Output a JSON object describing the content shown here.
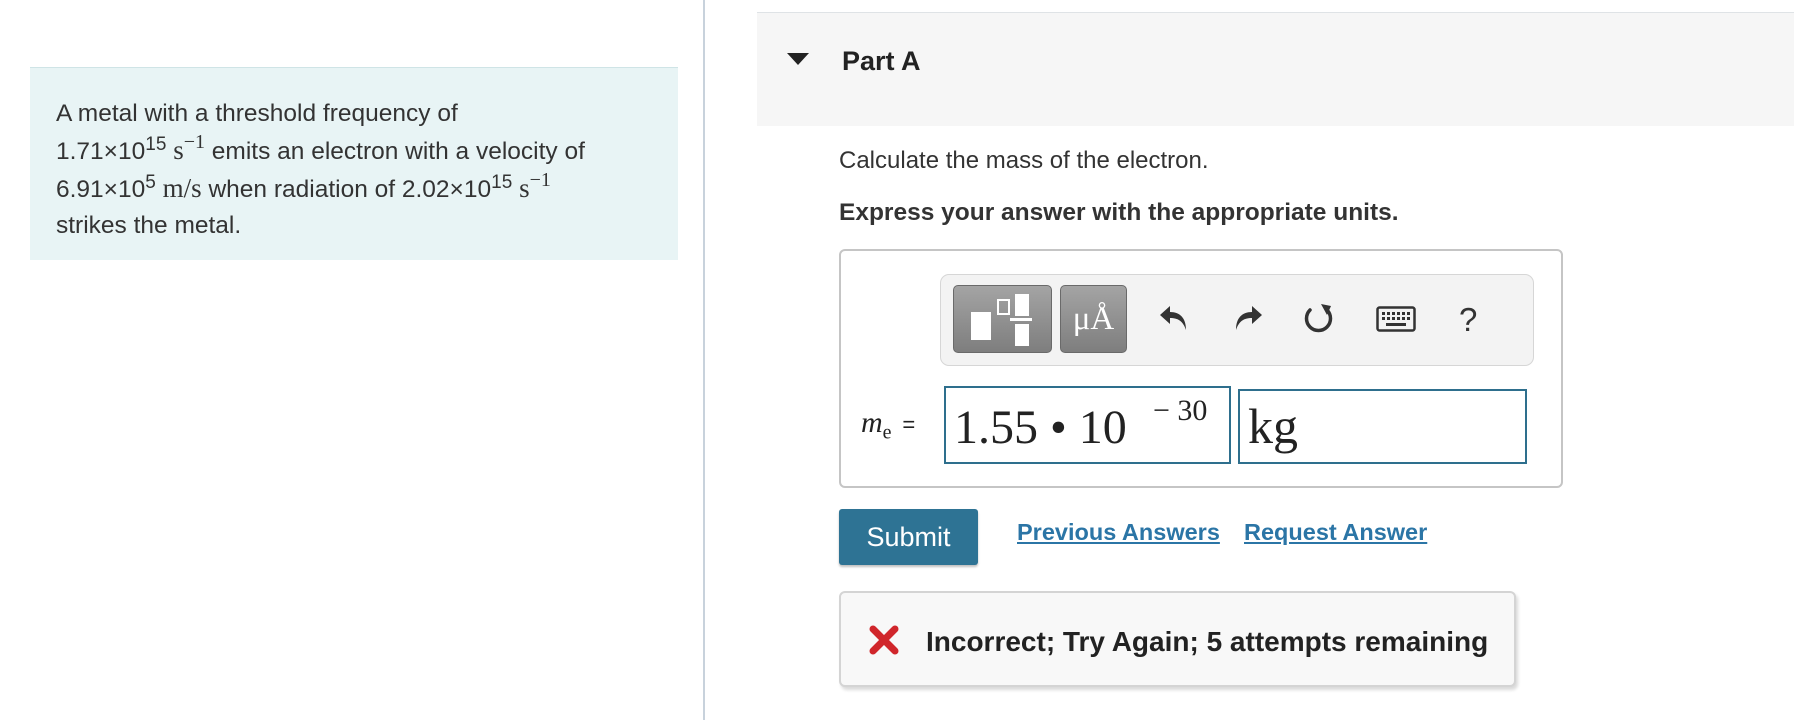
{
  "problem": {
    "text_intro": "A metal with a threshold frequency of",
    "freq_mantissa": "1.71×10",
    "freq_exp": "15",
    "freq_unit": "s",
    "freq_unit_exp": "−1",
    "emits_text": " emits an electron with a velocity of",
    "vel_mantissa": "6.91×10",
    "vel_exp": "5",
    "vel_unit": "m/s",
    "radiation_text": " when radiation of ",
    "rad_mantissa": "2.02×10",
    "rad_exp": "15",
    "rad_unit": "s",
    "rad_unit_exp": "−1",
    "text_end": "strikes the metal."
  },
  "part": {
    "title": "Part A",
    "question": "Calculate the mass of the electron.",
    "instruction": "Express your answer with the appropriate units."
  },
  "toolbar": {
    "units_label": "μÅ",
    "help_label": "?",
    "icons": [
      "templates-icon",
      "units-icon",
      "undo-icon",
      "redo-icon",
      "reset-icon",
      "keyboard-icon",
      "help-icon"
    ]
  },
  "answer": {
    "variable": "m",
    "variable_sub": "e",
    "equals": "=",
    "value_mantissa": "1.55 • 10",
    "value_exponent": "− 30",
    "unit": "kg"
  },
  "actions": {
    "submit_label": "Submit",
    "previous_answers_label": "Previous Answers",
    "request_answer_label": "Request Answer"
  },
  "feedback": {
    "message": "Incorrect; Try Again; 5 attempts remaining",
    "status_color": "#d0262b"
  },
  "colors": {
    "accent": "#2e7394",
    "link": "#2b75a6",
    "problem_bg": "#e8f4f5"
  }
}
